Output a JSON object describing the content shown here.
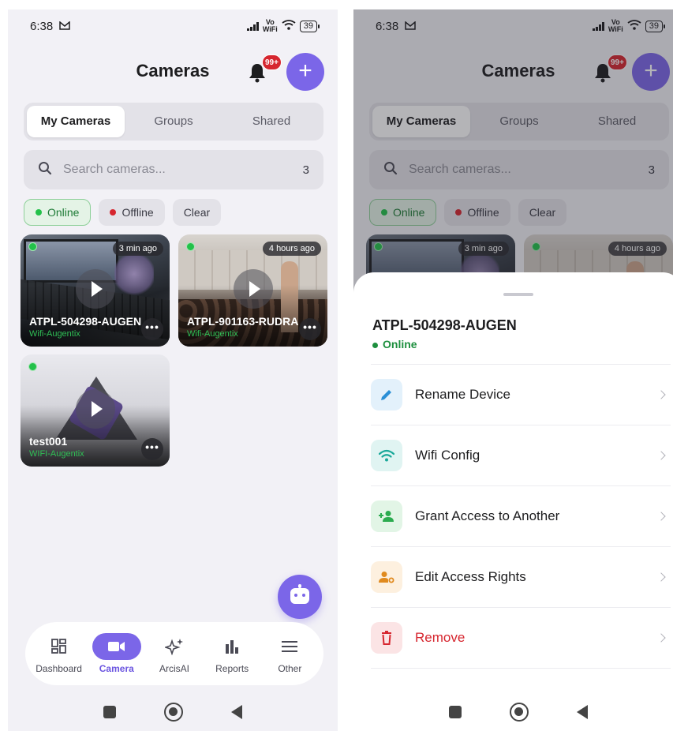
{
  "status_bar": {
    "time": "6:38",
    "vowifi_top": "Vo",
    "vowifi_bottom": "WiFi",
    "battery": "39"
  },
  "header": {
    "title": "Cameras",
    "notification_badge": "99+",
    "add_label": "+"
  },
  "tabs": [
    {
      "label": "My Cameras",
      "active": true
    },
    {
      "label": "Groups",
      "active": false
    },
    {
      "label": "Shared",
      "active": false
    }
  ],
  "search": {
    "placeholder": "Search cameras...",
    "count": "3"
  },
  "filters": {
    "online": "Online",
    "offline": "Offline",
    "clear": "Clear"
  },
  "cameras": [
    {
      "name": "ATPL-504298-AUGEN",
      "network": "Wifi-Augentix",
      "time": "3 min ago",
      "status": "online"
    },
    {
      "name": "ATPL-901163-RUDRA",
      "network": "Wifi-Augentix",
      "time": "4 hours ago",
      "status": "online"
    },
    {
      "name": "test001",
      "network": "WIFI-Augentix",
      "time": "",
      "status": "online"
    }
  ],
  "more_glyph": "•••",
  "nav": [
    {
      "label": "Dashboard",
      "icon": "dashboard-icon"
    },
    {
      "label": "Camera",
      "icon": "video-camera-icon",
      "active": true
    },
    {
      "label": "ArcisAI",
      "icon": "sparkle-icon"
    },
    {
      "label": "Reports",
      "icon": "bar-chart-icon"
    },
    {
      "label": "Other",
      "icon": "menu-icon"
    }
  ],
  "sheet": {
    "title": "ATPL-504298-AUGEN",
    "status": "Online",
    "items": [
      {
        "label": "Rename Device",
        "icon": "pencil-icon",
        "color": "#2a8fd6",
        "bg": "#e3f1fb"
      },
      {
        "label": "Wifi Config",
        "icon": "wifi-icon",
        "color": "#19a89a",
        "bg": "#e0f4f2"
      },
      {
        "label": "Grant Access to Another",
        "icon": "add-person-icon",
        "color": "#2bab4f",
        "bg": "#e2f5e6"
      },
      {
        "label": "Edit Access Rights",
        "icon": "person-settings-icon",
        "color": "#e08a1e",
        "bg": "#fdf0df"
      },
      {
        "label": "Remove",
        "icon": "trash-icon",
        "color": "#d6262f",
        "bg": "#fbe4e5"
      }
    ]
  },
  "colors": {
    "accent": "#7b66e8",
    "online": "#23c14a",
    "offline": "#d6262f"
  }
}
